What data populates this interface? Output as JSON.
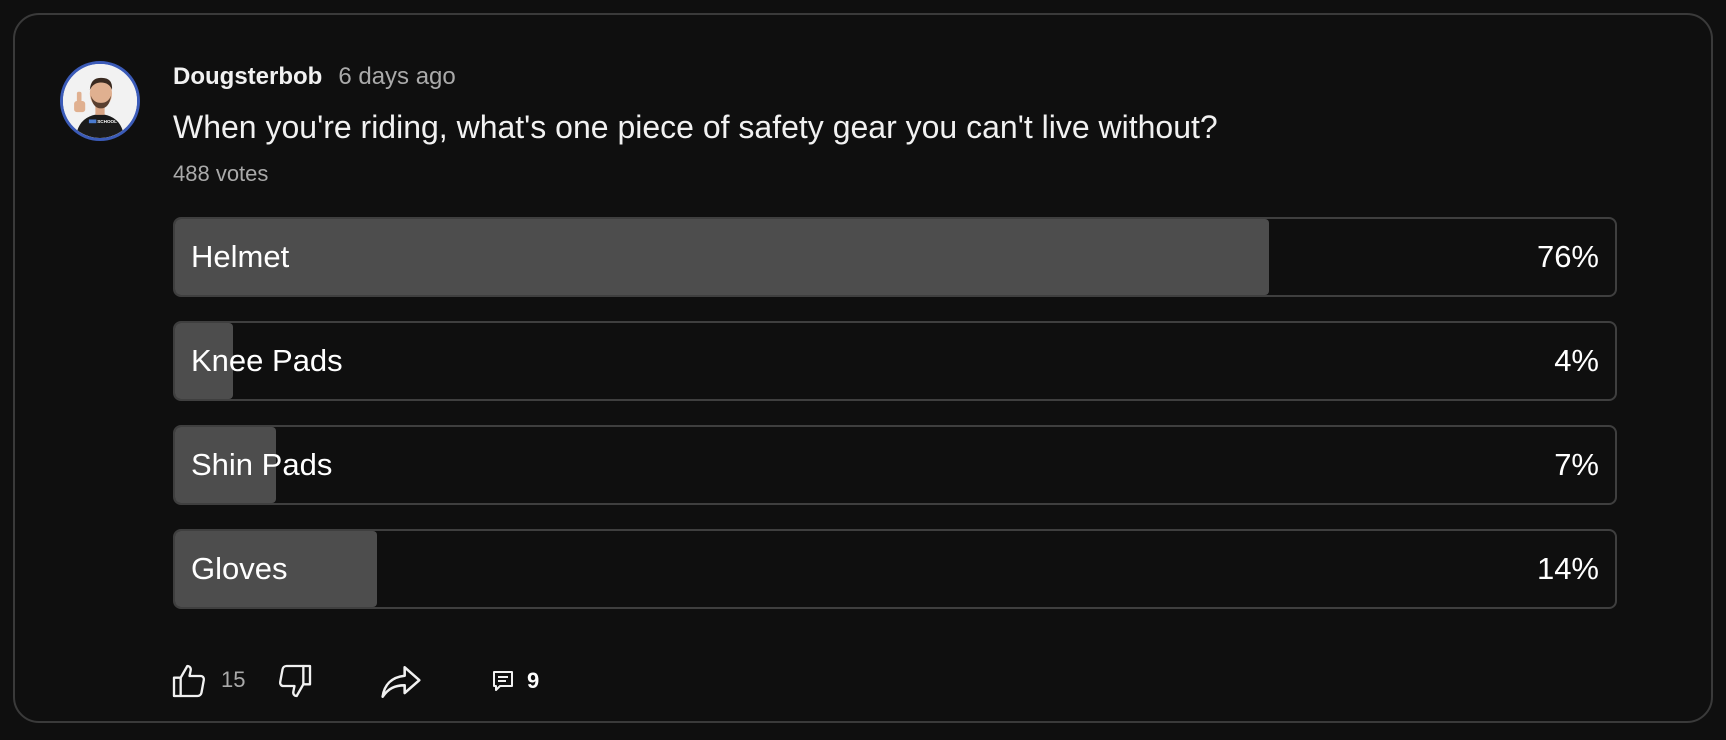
{
  "post": {
    "author": "Dougsterbob",
    "time": "6 days ago",
    "avatar_icon": "person-thumbs-up-avatar",
    "avatar_text": "SCHOOL"
  },
  "poll": {
    "question": "When you're riding, what's one piece of safety gear you can't live without?",
    "votes": "488 votes",
    "options": [
      {
        "label": "Helmet",
        "percent": "76%",
        "fraction": 0.76
      },
      {
        "label": "Knee Pads",
        "percent": "4%",
        "fraction": 0.04
      },
      {
        "label": "Shin Pads",
        "percent": "7%",
        "fraction": 0.07
      },
      {
        "label": "Gloves",
        "percent": "14%",
        "fraction": 0.14
      }
    ]
  },
  "actions": {
    "like_icon": "thumbs-up-icon",
    "like_count": "15",
    "dislike_icon": "thumbs-down-icon",
    "share_icon": "share-icon",
    "comment_icon": "comment-icon",
    "comment_count": "9"
  },
  "colors": {
    "background": "#0f0f0f",
    "card_border": "#3a3a3a",
    "option_fill": "#4d4d4d",
    "avatar_ring": "#3b5bb8",
    "secondary_text": "#aaaaaa"
  }
}
